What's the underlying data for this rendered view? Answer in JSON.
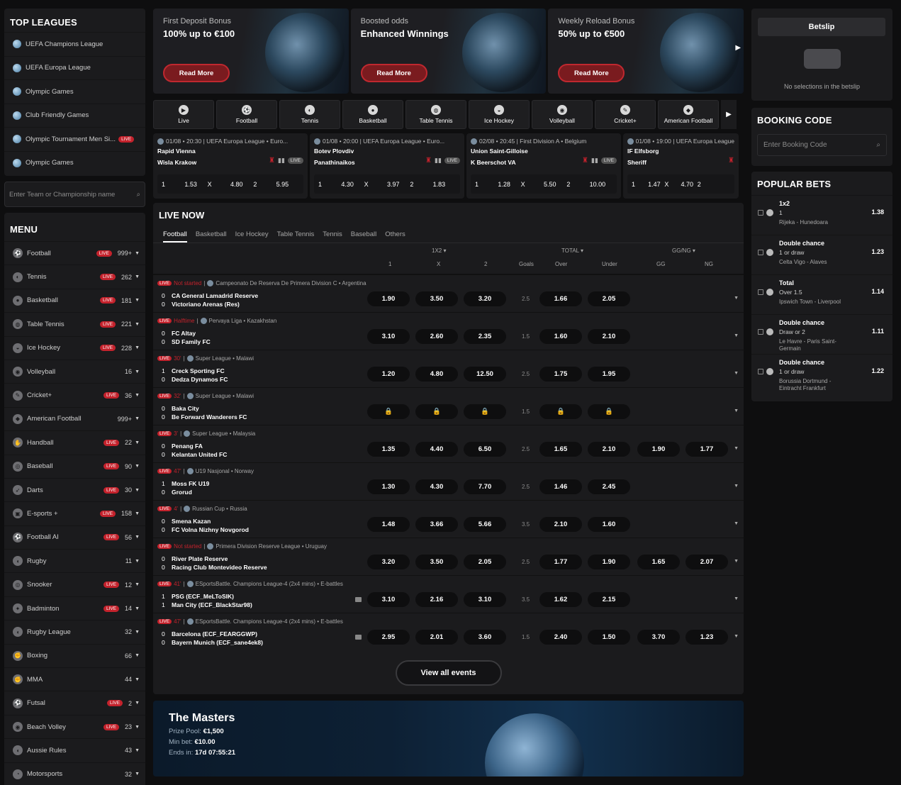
{
  "top_leagues": {
    "title": "TOP LEAGUES",
    "items": [
      {
        "label": "UEFA Champions League",
        "live": ""
      },
      {
        "label": "UEFA Europa League",
        "live": ""
      },
      {
        "label": "Olympic Games",
        "live": ""
      },
      {
        "label": "Club Friendly Games",
        "live": ""
      },
      {
        "label": "Olympic Tournament Men Si...",
        "live": "LIVE"
      },
      {
        "label": "Olympic Games",
        "live": ""
      }
    ],
    "search_placeholder": "Enter Team or Championship name"
  },
  "menu": {
    "title": "MENU",
    "items": [
      {
        "label": "Football",
        "live": "LIVE",
        "count": "999+"
      },
      {
        "label": "Tennis",
        "live": "LIVE",
        "count": "262"
      },
      {
        "label": "Basketball",
        "live": "LIVE",
        "count": "181"
      },
      {
        "label": "Table Tennis",
        "live": "LIVE",
        "count": "221"
      },
      {
        "label": "Ice Hockey",
        "live": "LIVE",
        "count": "228"
      },
      {
        "label": "Volleyball",
        "live": "",
        "count": "16"
      },
      {
        "label": "Cricket+",
        "live": "LIVE",
        "count": "36"
      },
      {
        "label": "American Football",
        "live": "",
        "count": "999+"
      },
      {
        "label": "Handball",
        "live": "LIVE",
        "count": "22"
      },
      {
        "label": "Baseball",
        "live": "LIVE",
        "count": "90"
      },
      {
        "label": "Darts",
        "live": "LIVE",
        "count": "30"
      },
      {
        "label": "E-sports +",
        "live": "LIVE",
        "count": "158"
      },
      {
        "label": "Football AI",
        "live": "LIVE",
        "count": "56"
      },
      {
        "label": "Rugby",
        "live": "",
        "count": "11"
      },
      {
        "label": "Snooker",
        "live": "LIVE",
        "count": "12"
      },
      {
        "label": "Badminton",
        "live": "LIVE",
        "count": "14"
      },
      {
        "label": "Rugby League",
        "live": "",
        "count": "32"
      },
      {
        "label": "Boxing",
        "live": "",
        "count": "66"
      },
      {
        "label": "MMA",
        "live": "",
        "count": "44"
      },
      {
        "label": "Futsal",
        "live": "LIVE",
        "count": "2"
      },
      {
        "label": "Beach Volley",
        "live": "LIVE",
        "count": "23"
      },
      {
        "label": "Aussie Rules",
        "live": "",
        "count": "43"
      },
      {
        "label": "Motorsports",
        "live": "",
        "count": "32"
      }
    ]
  },
  "banners": [
    {
      "subtitle": "First Deposit Bonus",
      "title": "100% up to €100",
      "button": "Read More"
    },
    {
      "subtitle": "Boosted odds",
      "title": "Enhanced Winnings",
      "button": "Read More"
    },
    {
      "subtitle": "Weekly Reload Bonus",
      "title": "50% up to €500",
      "button": "Read More"
    }
  ],
  "sports_bar": [
    "Live",
    "Football",
    "Tennis",
    "Basketball",
    "Table Tennis",
    "Ice Hockey",
    "Volleyball",
    "Cricket+",
    "American Football"
  ],
  "featured": [
    {
      "head": "01/08 • 20:30 | UEFA Europa League • Euro...",
      "team1": "Rapid Vienna",
      "team2": "Wisla Krakow",
      "live": "LIVE",
      "odds": [
        "1",
        "1.53",
        "X",
        "4.80",
        "2",
        "5.95"
      ]
    },
    {
      "head": "01/08 • 20:00 | UEFA Europa League • Euro...",
      "team1": "Botev Plovdiv",
      "team2": "Panathinaikos",
      "live": "LIVE",
      "odds": [
        "1",
        "4.30",
        "X",
        "3.97",
        "2",
        "1.83"
      ]
    },
    {
      "head": "02/08 • 20:45 | First Division A • Belgium",
      "team1": "Union Saint-Gilloise",
      "team2": "K Beerschot VA",
      "live": "LIVE",
      "odds": [
        "1",
        "1.28",
        "X",
        "5.50",
        "2",
        "10.00"
      ]
    },
    {
      "head": "01/08 • 19:00 | UEFA Europa League",
      "team1": "IF Elfsborg",
      "team2": "Sheriff",
      "live": "",
      "odds": [
        "1",
        "1.47",
        "X",
        "4.70",
        "2",
        ""
      ]
    }
  ],
  "live_now": {
    "title": "LIVE NOW",
    "tabs": [
      "Football",
      "Basketball",
      "Ice Hockey",
      "Table Tennis",
      "Tennis",
      "Baseball",
      "Others"
    ],
    "headers": {
      "group_1x2": "1X2",
      "group_total": "TOTAL",
      "group_ggng": "GG/NG",
      "c1": "1",
      "cx": "X",
      "c2": "2",
      "goals": "Goals",
      "over": "Over",
      "under": "Under",
      "gg": "GG",
      "ng": "NG"
    },
    "events": [
      {
        "status": "Not started",
        "league": "Campeonato De Reserva De Primera Division C • Argentina",
        "s1": "0",
        "s2": "0",
        "t1": "CA General Lamadrid Reserve",
        "t2": "Victoriano Arenas (Res)",
        "o1": "1.90",
        "ox": "3.50",
        "o2": "3.20",
        "goals": "2.5",
        "over": "1.66",
        "under": "2.05",
        "gg": "",
        "ng": ""
      },
      {
        "status": "Halftime",
        "league": "Pervaya Liga • Kazakhstan",
        "s1": "0",
        "s2": "0",
        "t1": "FC Altay",
        "t2": "SD Family FC",
        "o1": "3.10",
        "ox": "2.60",
        "o2": "2.35",
        "goals": "1.5",
        "over": "1.60",
        "under": "2.10",
        "gg": "",
        "ng": ""
      },
      {
        "status": "30'",
        "league": "Super League • Malawi",
        "s1": "1",
        "s2": "0",
        "t1": "Creck Sporting FC",
        "t2": "Dedza Dynamos FC",
        "o1": "1.20",
        "ox": "4.80",
        "o2": "12.50",
        "goals": "2.5",
        "over": "1.75",
        "under": "1.95",
        "gg": "",
        "ng": ""
      },
      {
        "status": "32'",
        "league": "Super League • Malawi",
        "s1": "0",
        "s2": "0",
        "t1": "Baka City",
        "t2": "Be Forward Wanderers FC",
        "o1": "🔒",
        "ox": "🔒",
        "o2": "🔒",
        "goals": "1.5",
        "over": "🔒",
        "under": "🔒",
        "gg": "",
        "ng": ""
      },
      {
        "status": "3'",
        "league": "Super League • Malaysia",
        "s1": "0",
        "s2": "0",
        "t1": "Penang FA",
        "t2": "Kelantan United FC",
        "o1": "1.35",
        "ox": "4.40",
        "o2": "6.50",
        "goals": "2.5",
        "over": "1.65",
        "under": "2.10",
        "gg": "1.90",
        "ng": "1.77"
      },
      {
        "status": "47'",
        "league": "U19 Nasjonal • Norway",
        "s1": "1",
        "s2": "0",
        "t1": "Moss FK U19",
        "t2": "Grorud",
        "o1": "1.30",
        "ox": "4.30",
        "o2": "7.70",
        "goals": "2.5",
        "over": "1.46",
        "under": "2.45",
        "gg": "",
        "ng": ""
      },
      {
        "status": "4'",
        "league": "Russian Cup • Russia",
        "s1": "0",
        "s2": "0",
        "t1": "Smena Kazan",
        "t2": "FC Volna Nizhny Novgorod",
        "o1": "1.48",
        "ox": "3.66",
        "o2": "5.66",
        "goals": "3.5",
        "over": "2.10",
        "under": "1.60",
        "gg": "",
        "ng": ""
      },
      {
        "status": "Not started",
        "league": "Primera Division Reserve League • Uruguay",
        "s1": "0",
        "s2": "0",
        "t1": "River Plate Reserve",
        "t2": "Racing Club Montevideo Reserve",
        "o1": "3.20",
        "ox": "3.50",
        "o2": "2.05",
        "goals": "2.5",
        "over": "1.77",
        "under": "1.90",
        "gg": "1.65",
        "ng": "2.07"
      },
      {
        "status": "41'",
        "league": "ESportsBattle. Champions League-4 (2x4 mins) • E-battles",
        "s1": "1",
        "s2": "1",
        "t1": "PSG (ECF_MeLToSIK)",
        "t2": "Man City (ECF_BlackStar98)",
        "o1": "3.10",
        "ox": "2.16",
        "o2": "3.10",
        "goals": "3.5",
        "over": "1.62",
        "under": "2.15",
        "gg": "",
        "ng": ""
      },
      {
        "status": "47'",
        "league": "ESportsBattle. Champions League-4 (2x4 mins) • E-battles",
        "s1": "0",
        "s2": "0",
        "t1": "Barcelona (ECF_FEARGGWP)",
        "t2": "Bayern Munich (ECF_sane4ek8)",
        "o1": "2.95",
        "ox": "2.01",
        "o2": "3.60",
        "goals": "1.5",
        "over": "2.40",
        "under": "1.50",
        "gg": "3.70",
        "ng": "1.23"
      }
    ],
    "view_all": "View all events"
  },
  "masters": {
    "title": "The Masters",
    "prize_label": "Prize Pool:",
    "prize_value": "€1,500",
    "minbet_label": "Min bet:",
    "minbet_value": "€10.00",
    "ends_label": "Ends in:",
    "ends_value": "17d 07:55:21"
  },
  "betslip": {
    "tab": "Betslip",
    "empty": "No selections in the betslip"
  },
  "booking": {
    "title": "BOOKING CODE",
    "placeholder": "Enter Booking Code"
  },
  "popular": {
    "title": "POPULAR BETS",
    "items": [
      {
        "market": "1x2",
        "selection": "1",
        "match": "Rijeka - Hunedoara",
        "odd": "1.38"
      },
      {
        "market": "Double chance",
        "selection": "1 or draw",
        "match": "Celta Vigo - Alaves",
        "odd": "1.23"
      },
      {
        "market": "Total",
        "selection": "Over 1.5",
        "match": "Ipswich Town - Liverpool",
        "odd": "1.14"
      },
      {
        "market": "Double chance",
        "selection": "Draw or 2",
        "match": "Le Havre - Paris Saint-Germain",
        "odd": "1.11"
      },
      {
        "market": "Double chance",
        "selection": "1 or draw",
        "match": "Borussia Dortmund - Eintracht Frankfurt",
        "odd": "1.22"
      }
    ]
  },
  "colors": {
    "accent": "#c4222c",
    "background": "#0e0e0f",
    "panel": "#1b1b1d"
  }
}
